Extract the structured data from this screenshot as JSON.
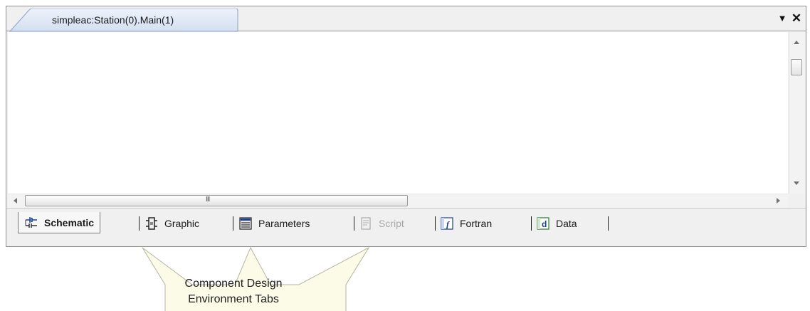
{
  "window": {
    "tab_title": "simpleac:Station(0).Main(1)",
    "dropdown_glyph": "▼",
    "close_glyph": "✕"
  },
  "scrollbar": {
    "grip_glyph": "III"
  },
  "env_tabs": [
    {
      "label": "Schematic",
      "icon": "schematic-icon",
      "state": "active"
    },
    {
      "label": "Graphic",
      "icon": "graphic-icon",
      "state": "normal"
    },
    {
      "label": "Parameters",
      "icon": "parameters-icon",
      "state": "normal"
    },
    {
      "label": "Script",
      "icon": "script-icon",
      "state": "disabled"
    },
    {
      "label": "Fortran",
      "icon": "fortran-icon",
      "state": "normal"
    },
    {
      "label": "Data",
      "icon": "data-icon",
      "state": "normal"
    }
  ],
  "callout": {
    "line1": "Component Design",
    "line2": "Environment Tabs"
  },
  "colors": {
    "tab_fill": "#dde6f3",
    "callout_fill": "#fbfbe8",
    "callout_border": "#b5b5a0"
  }
}
